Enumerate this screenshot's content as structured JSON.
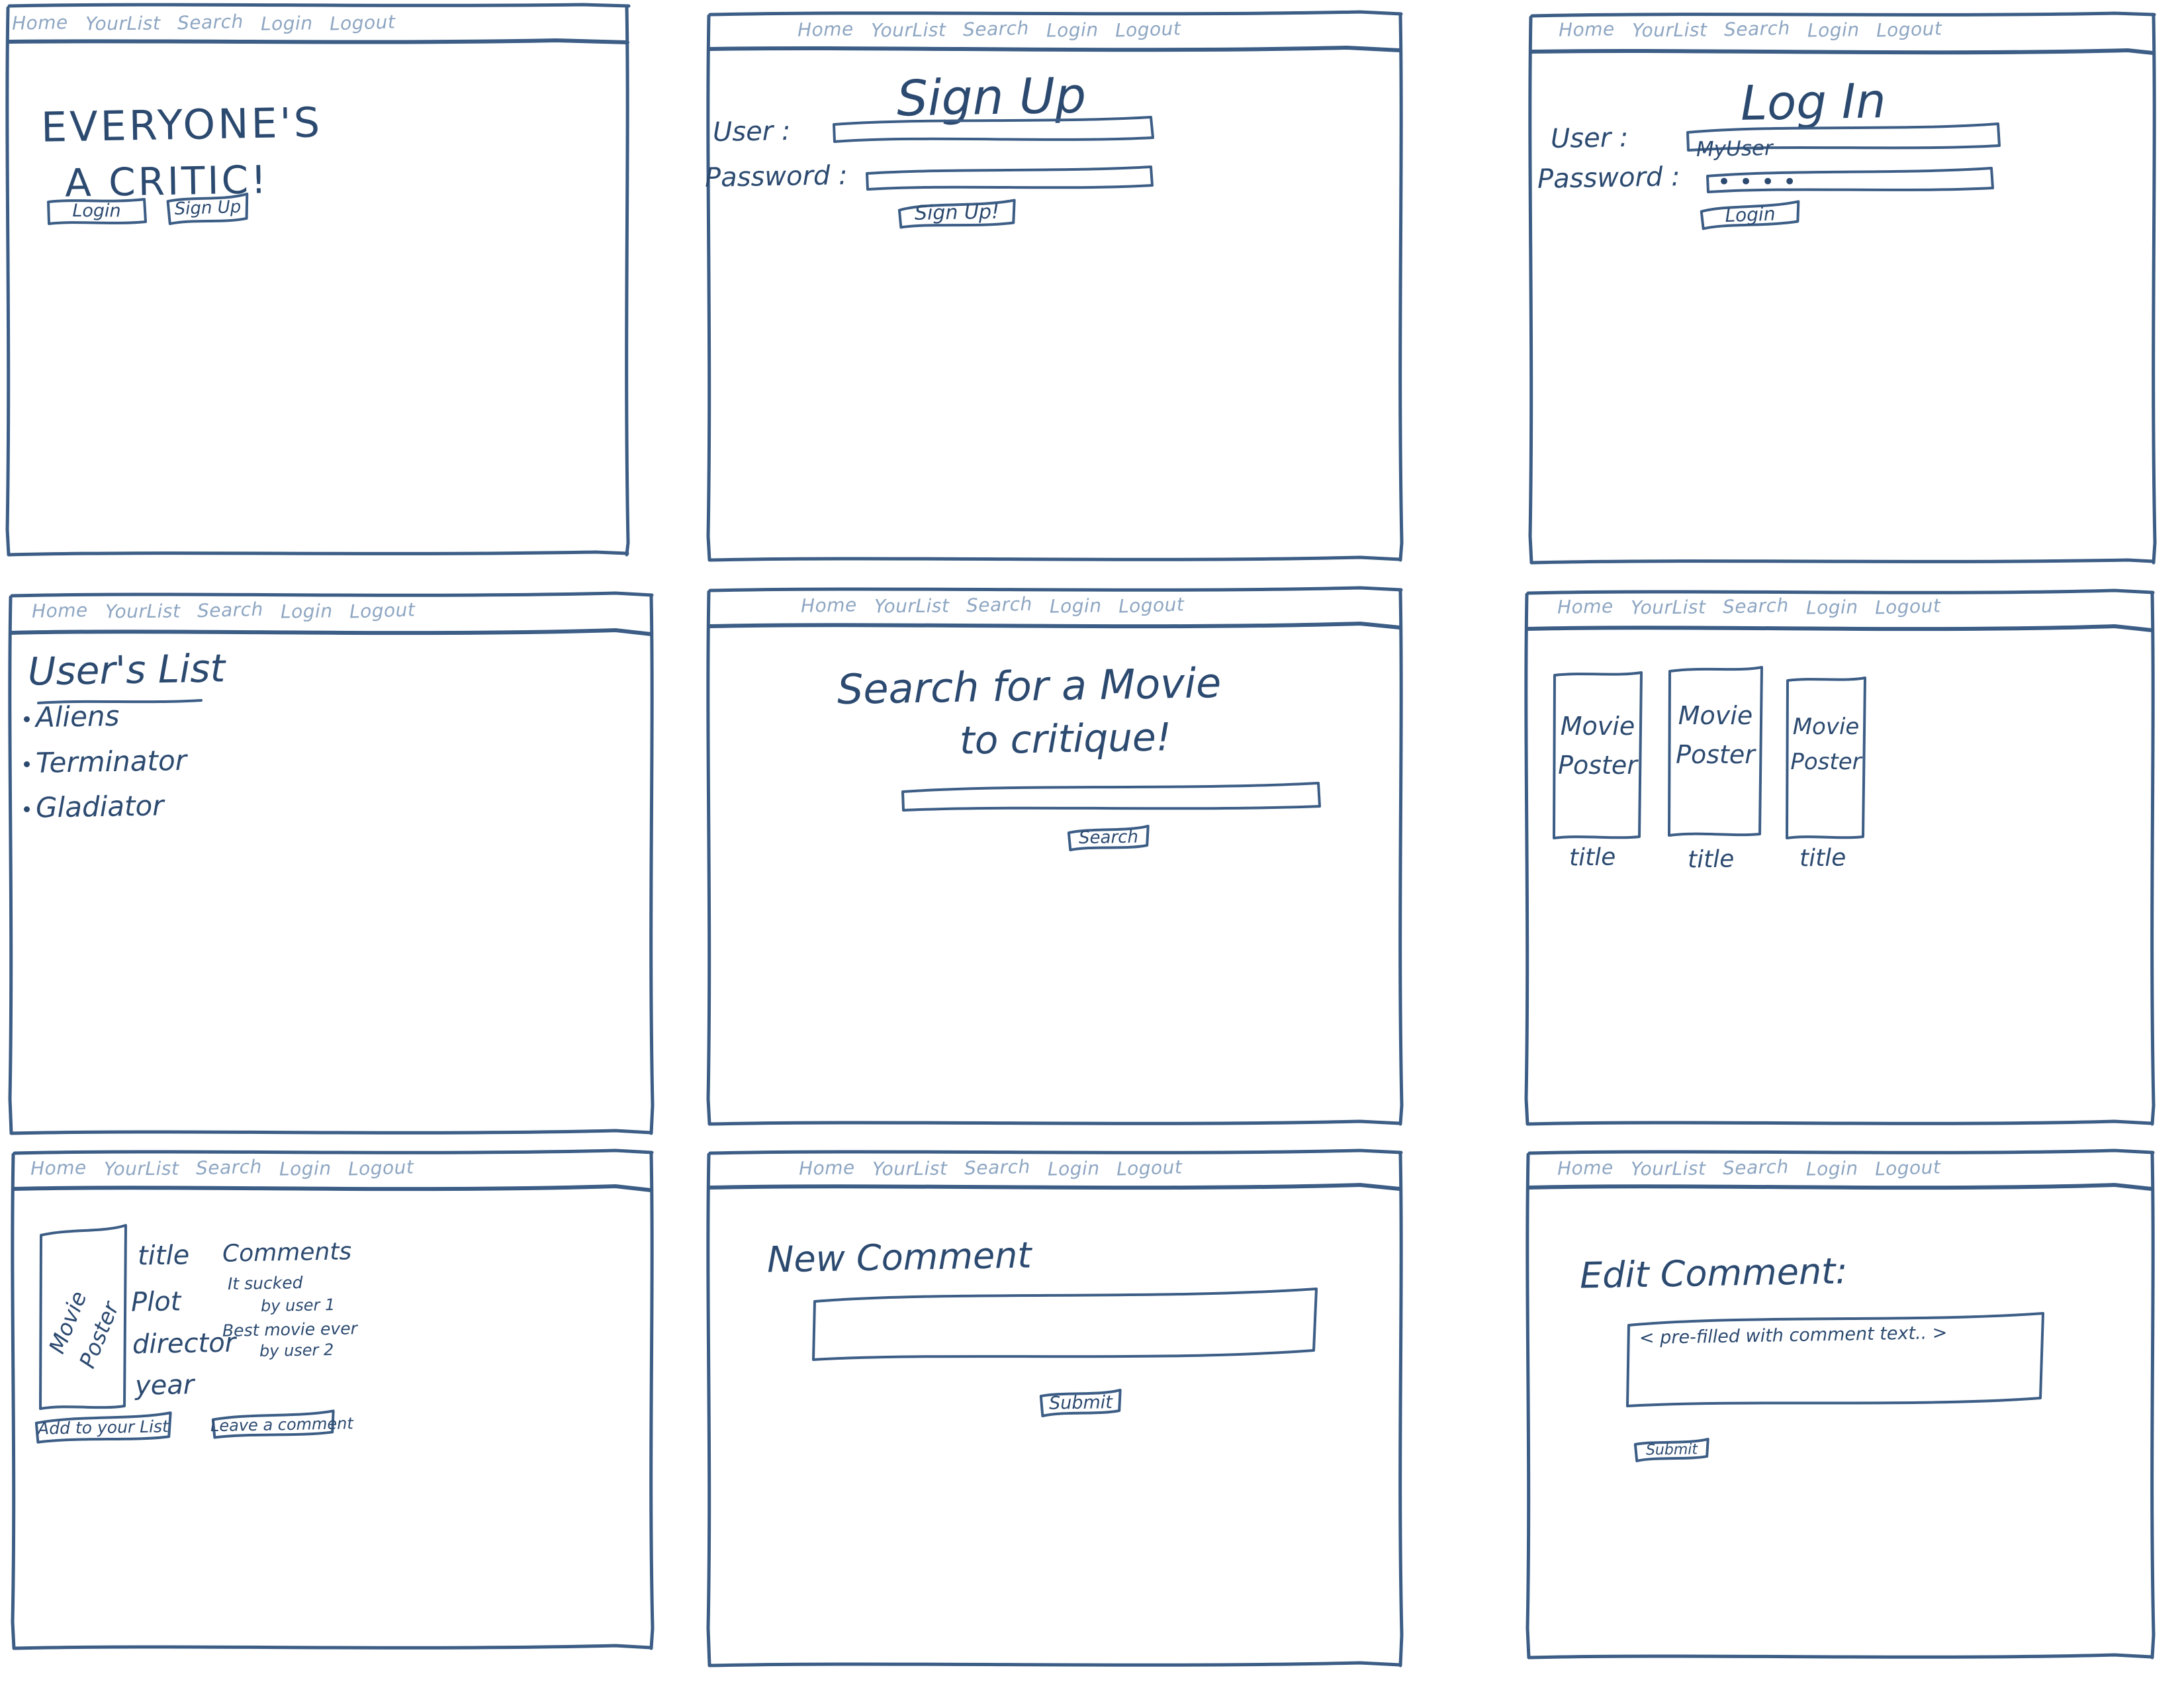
{
  "meta": {
    "ink_color": "#3c5d85",
    "ink_dark": "#2c4a70",
    "nav_ink": "#8ea6c2",
    "paper_color": "#ffffff",
    "style": "hand-drawn pencil wireframe sketch"
  },
  "nav": {
    "items": [
      "Home",
      "YourList",
      "Search",
      "Login",
      "Logout"
    ]
  },
  "panels": [
    {
      "id": "home",
      "name": "home-screen",
      "headline_line1": "EVERYONE'S",
      "headline_line2": "A CRITIC!",
      "buttons": [
        {
          "label": "Login",
          "name": "login-button"
        },
        {
          "label": "Sign Up",
          "name": "signup-button"
        }
      ]
    },
    {
      "id": "signup",
      "name": "signup-screen",
      "title": "Sign Up",
      "fields": [
        {
          "label": "User :",
          "value": "",
          "name": "username-field"
        },
        {
          "label": "Password :",
          "value": "",
          "name": "password-field"
        }
      ],
      "submit": {
        "label": "Sign Up!",
        "name": "signup-submit-button"
      }
    },
    {
      "id": "login",
      "name": "login-screen",
      "title": "Log In",
      "fields": [
        {
          "label": "User :",
          "value": "MyUser",
          "name": "username-field"
        },
        {
          "label": "Password :",
          "value": "••••",
          "name": "password-field"
        }
      ],
      "submit": {
        "label": "Login",
        "name": "login-submit-button"
      }
    },
    {
      "id": "userlist",
      "name": "user-list-screen",
      "title": "User's List",
      "items": [
        "Aliens",
        "Terminator",
        "Gladiator"
      ]
    },
    {
      "id": "search",
      "name": "search-screen",
      "title_line1": "Search for a Movie",
      "title_line2": "to critique!",
      "input_value": "",
      "submit": {
        "label": "Search",
        "name": "search-submit-button"
      }
    },
    {
      "id": "results",
      "name": "search-results-screen",
      "cards": [
        {
          "poster_text": "Movie\nPoster",
          "caption": "title"
        },
        {
          "poster_text": "Movie\nPoster",
          "caption": "title"
        },
        {
          "poster_text": "Movie\nPoster",
          "caption": "title"
        }
      ]
    },
    {
      "id": "detail",
      "name": "movie-detail-screen",
      "poster_text": "Movie Poster",
      "meta_fields": [
        "title",
        "Plot",
        "director",
        "year"
      ],
      "comments_heading": "Comments",
      "comments": [
        {
          "text": "It sucked",
          "author": "by user 1"
        },
        {
          "text": "Best movie ever",
          "author": "by user 2"
        }
      ],
      "buttons": [
        {
          "label": "Add to your List",
          "name": "add-to-list-button"
        },
        {
          "label": "Leave a comment",
          "name": "leave-comment-button"
        }
      ]
    },
    {
      "id": "newcomment",
      "name": "new-comment-screen",
      "title": "New Comment",
      "textarea_value": "",
      "submit": {
        "label": "Submit",
        "name": "new-comment-submit-button"
      }
    },
    {
      "id": "editcomment",
      "name": "edit-comment-screen",
      "title": "Edit Comment:",
      "textarea_value": "< pre-filled with comment text.. >",
      "submit": {
        "label": "Submit",
        "name": "edit-comment-submit-button"
      }
    }
  ]
}
